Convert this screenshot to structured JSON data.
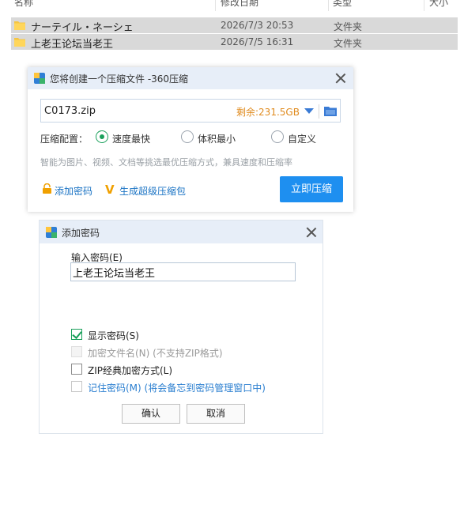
{
  "explorer": {
    "columns": [
      "名称",
      "修改日期",
      "类型",
      "大小"
    ],
    "files": [
      {
        "name": "ナーテイル・ネーシェ",
        "date": "2026/7/3 20:53",
        "type": "文件夹"
      },
      {
        "name": "上老王论坛当老王",
        "date": "2026/7/5 16:31",
        "type": "文件夹"
      }
    ]
  },
  "compress_dialog": {
    "title": "您将创建一个压缩文件 -360压缩",
    "filename": "C0173.zip",
    "free_space": "剩余:231.5GB",
    "config_label": "压缩配置：",
    "options": [
      "速度最快",
      "体积最小",
      "自定义"
    ],
    "selected_option": "速度最快",
    "hint": "智能为图片、视频、文档等挑选最优压缩方式，兼具速度和压缩率",
    "add_password_link": "添加密码",
    "super_package_link": "生成超级压缩包",
    "compress_button": "立即压缩",
    "colors": {
      "accent": "#1e8ff0",
      "space": "#e08b1e",
      "radio": "#1aa05b"
    }
  },
  "password_dialog": {
    "title": "添加密码",
    "input_label": "输入密码(E)",
    "password_value": "上老王论坛当老王",
    "checkboxes": [
      {
        "label": "显示密码(S)",
        "checked": true,
        "enabled": true
      },
      {
        "label": "加密文件名(N) (不支持ZIP格式)",
        "checked": false,
        "enabled": false
      },
      {
        "label": "ZIP经典加密方式(L)",
        "checked": false,
        "enabled": true
      },
      {
        "label": "记住密码(M) (将会备忘到密码管理窗口中)",
        "checked": false,
        "enabled": true
      }
    ],
    "ok_button": "确认",
    "cancel_button": "取消"
  }
}
